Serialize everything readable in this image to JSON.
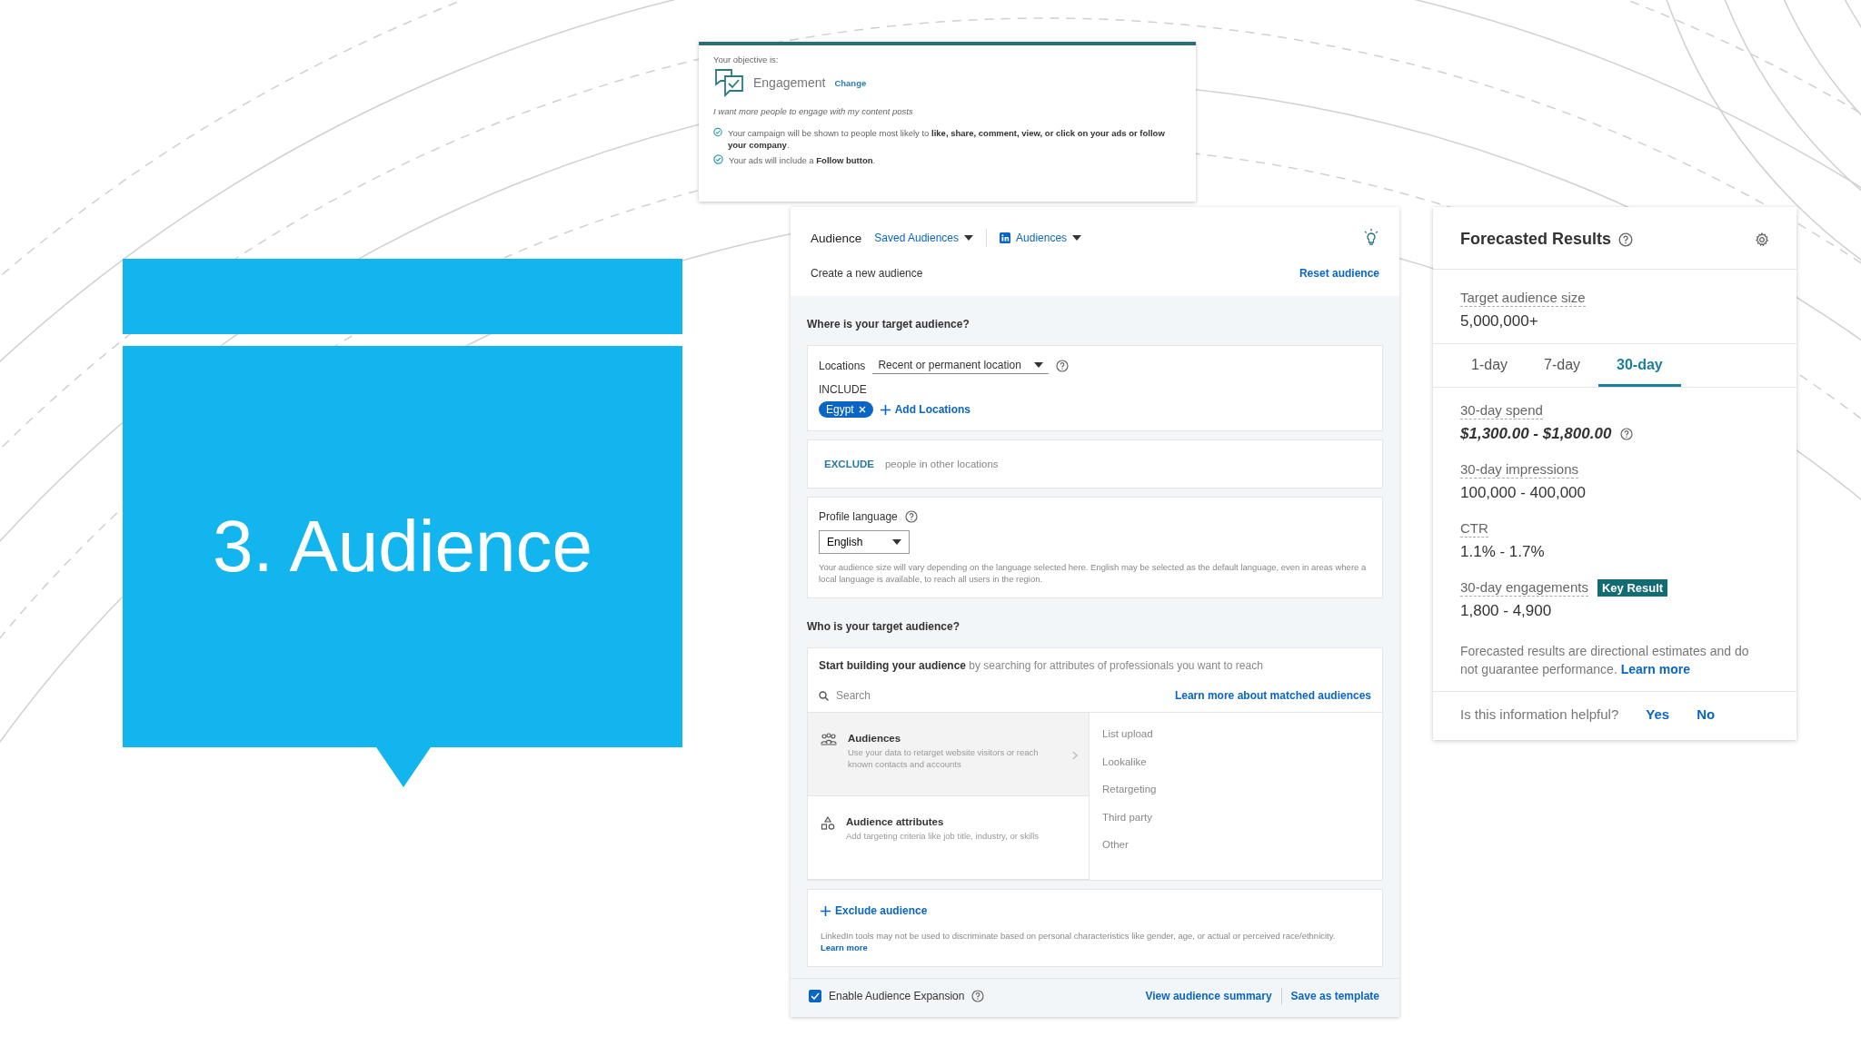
{
  "slide": {
    "title": "3. Audience"
  },
  "objective_panel": {
    "caption": "Your objective is:",
    "objective": "Engagement",
    "change_link": "Change",
    "description": "I want more people to engage with my content posts",
    "notes": [
      "Your campaign will be shown to people most likely to **like, share, comment, view, or click on your ads or follow your company**.",
      "Your ads will include a **Follow button**."
    ]
  },
  "audience_panel": {
    "title": "Audience",
    "menus": [
      {
        "label": "Saved Audiences",
        "kind": "plain"
      },
      {
        "label": "Audiences",
        "kind": "branded"
      }
    ],
    "subtitle": "Create a new audience",
    "reset_link": "Reset audience",
    "location_section": {
      "heading": "Where is your target audience?",
      "label": "Locations",
      "location_type": "Recent or permanent location",
      "include_label": "INCLUDE",
      "included": [
        "Egypt"
      ],
      "add_link": "Add Locations",
      "exclude_label": "EXCLUDE",
      "exclude_placeholder": "people in other locations"
    },
    "language": {
      "label": "Profile language",
      "value": "English",
      "help": "Your audience size will vary depending on the language selected here. English may be selected as the default language, even in areas where a local language is available, to reach all users in the region."
    },
    "targeting": {
      "heading": "Who is your target audience?",
      "intro": "**Start building your audience** by searching for attributes of professionals you want to reach",
      "search_placeholder": "Search",
      "learn_link": "Learn more about matched audiences",
      "categories": [
        {
          "kind": "people",
          "title": "Audiences",
          "description": "Use your data to retarget website visitors or reach known contacts and accounts",
          "selected": true
        },
        {
          "kind": "shapes",
          "title": "Audience attributes",
          "description": "Add targeting criteria like job title, industry, or skills",
          "selected": false
        }
      ],
      "options": [
        "List upload",
        "Lookalike",
        "Retargeting",
        "Third party",
        "Other"
      ]
    },
    "exclude": {
      "link": "Exclude audience",
      "disclaimer": "LinkedIn tools may not be used to discriminate based on personal characteristics like gender, age, or actual or perceived race/ethnicity.",
      "learn_link": "Learn more"
    },
    "footer": {
      "expansion_label": "Enable Audience Expansion",
      "expansion_checked": true,
      "links": [
        "View audience summary",
        "Save as template"
      ]
    }
  },
  "forecast_panel": {
    "title": "Forecasted Results",
    "audience_label": "Target audience size",
    "audience_value": "5,000,000+",
    "tabs": [
      {
        "label": "1-day",
        "selected": false
      },
      {
        "label": "7-day",
        "selected": false
      },
      {
        "label": "30-day",
        "selected": true
      }
    ],
    "metrics": [
      {
        "label": "30-day spend",
        "value": "$1,300.00 - $1,800.00",
        "kind": "spend"
      },
      {
        "label": "30-day impressions",
        "value": "100,000 - 400,000",
        "kind": "plain"
      },
      {
        "label": "CTR",
        "value": "1.1% - 1.7%",
        "kind": "plain"
      },
      {
        "label": "30-day engagements",
        "value": "1,800 - 4,900",
        "kind": "key",
        "badge": "Key Result"
      }
    ],
    "note": "Forecasted results are directional estimates and do not guarantee performance.",
    "learn_link": "Learn more",
    "feedback": {
      "question": "Is this information helpful?",
      "answers": [
        "Yes",
        "No"
      ]
    }
  }
}
